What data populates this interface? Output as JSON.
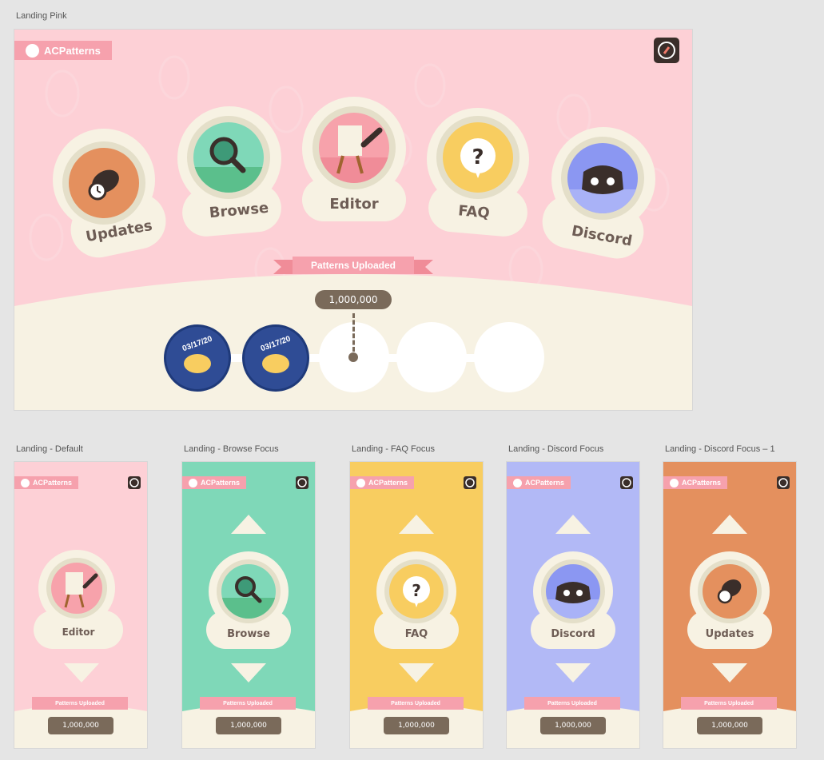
{
  "frames": {
    "main_label": "Landing Pink",
    "small_labels": [
      "Landing - Default",
      "Landing - Browse Focus",
      "Landing - FAQ Focus",
      "Landing - Discord Focus",
      "Landing - Discord Focus – 1"
    ]
  },
  "brand": {
    "name": "ACPatterns"
  },
  "nav": {
    "updates": "Updates",
    "browse": "Browse",
    "editor": "Editor",
    "faq": "FAQ",
    "discord": "Discord"
  },
  "stats": {
    "ribbon": "Patterns Uploaded",
    "count": "1,000,000"
  },
  "badges": {
    "date": "03/17/20"
  },
  "icons": {
    "logo": "leaf-brush-icon",
    "compass": "compass-icon",
    "updates": "clock-bag-icon",
    "browse": "magnifier-globe-icon",
    "editor": "easel-brush-icon",
    "faq": "question-bubble-icon",
    "discord": "discord-icon"
  },
  "colors": {
    "pink": "#fdd0d6",
    "green": "#7fd8b8",
    "yellow": "#f8cd60",
    "lavender": "#b2b9f6",
    "orange": "#e4905e",
    "cream": "#f7f2e3",
    "pill": "#7a6a5a",
    "ribbon": "#f6a1ad"
  }
}
